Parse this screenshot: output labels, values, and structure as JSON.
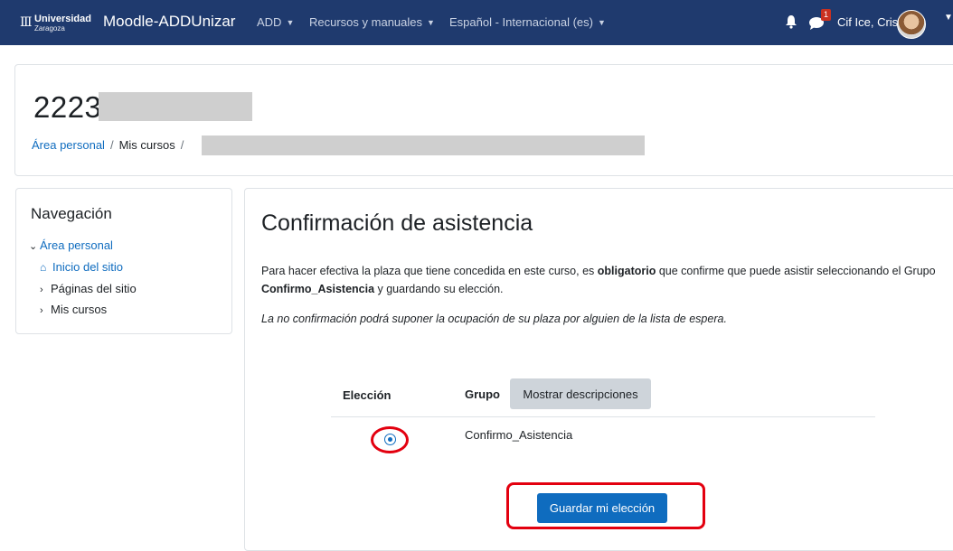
{
  "navbar": {
    "logo_line1": "Universidad",
    "logo_line2": "Zaragoza",
    "site_name": "Moodle-ADDUnizar",
    "menu": [
      {
        "label": "ADD"
      },
      {
        "label": "Recursos y manuales"
      },
      {
        "label": "Español - Internacional (es)"
      }
    ],
    "notification_count": "1",
    "user_name": "Cif Ice, Cris",
    "icons": [
      "university-logo-icon",
      "bell-icon",
      "chat-icon",
      "avatar",
      "chevron-down-icon"
    ]
  },
  "header": {
    "course_code": "2223",
    "breadcrumb": [
      "Área personal",
      "Mis cursos"
    ],
    "separator": "/"
  },
  "navigation": {
    "title": "Navegación",
    "items": [
      {
        "label": "Área personal"
      },
      {
        "label": "Inicio del sitio"
      },
      {
        "label": "Páginas del sitio"
      },
      {
        "label": "Mis cursos"
      }
    ]
  },
  "main": {
    "title": "Confirmación de asistencia",
    "intro_part1": "Para hacer efectiva la plaza que tiene concedida en este curso, es ",
    "intro_bold1": "obligatorio",
    "intro_part2": " que confirme que puede asistir seleccionando el Grupo ",
    "intro_bold2": "Confirmo_Asistencia",
    "intro_part3": " y guardando su elección.",
    "warning": "La no confirmación podrá suponer la ocupación de su plaza por alguien de la lista de espera.",
    "table": {
      "col_choice": "Elección",
      "col_group": "Grupo",
      "show_descriptions": "Mostrar descripciones",
      "rows": [
        {
          "option": "Confirmo_Asistencia",
          "selected": true
        }
      ]
    },
    "save_button": "Guardar mi elección",
    "highlight_color": "#e3000f",
    "accent_color": "#0f6cbf"
  }
}
